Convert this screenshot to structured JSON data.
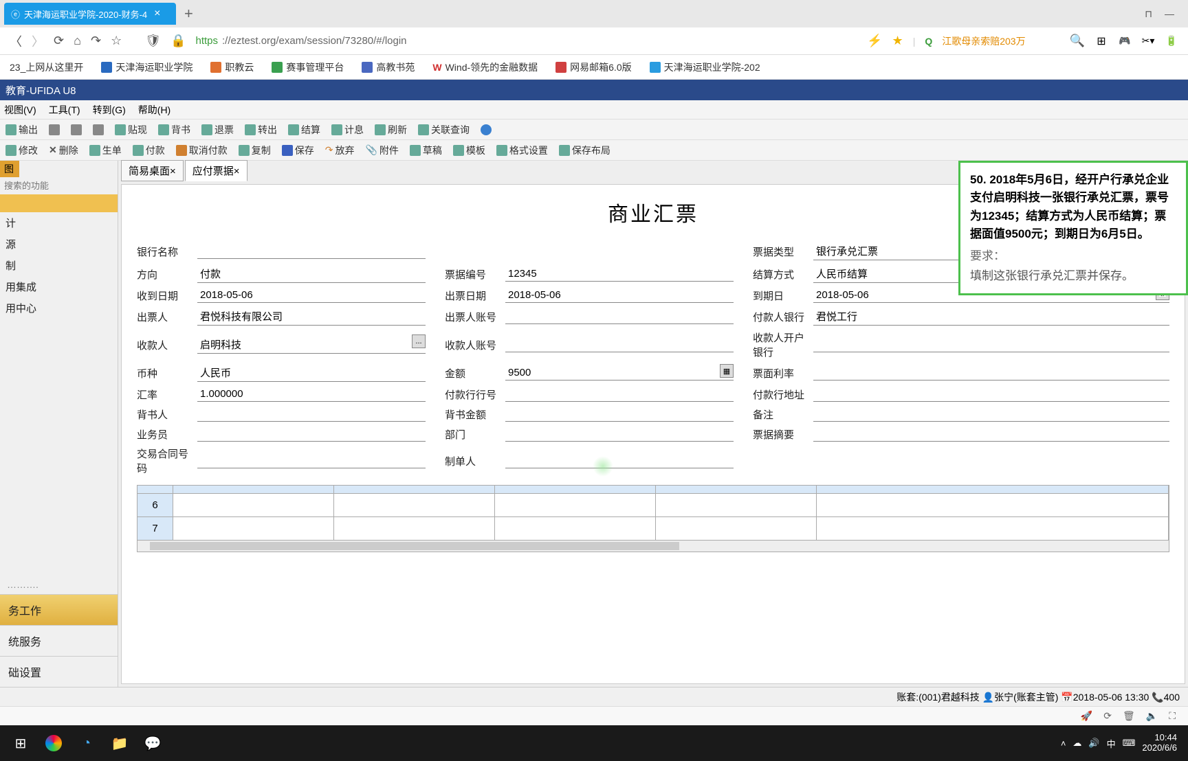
{
  "browser": {
    "tab_title": "天津海运职业学院-2020-财务-4",
    "url_scheme": "https",
    "url_host_path": "://eztest.org/exam/session/73280/#/login",
    "search_hint": "江歌母亲索赔203万",
    "win_pin": "⊓",
    "win_min": "—"
  },
  "bookmarks": [
    "23_上网从这里开",
    "天津海运职业学院",
    "职教云",
    "赛事管理平台",
    "高教书苑",
    "Wind-领先的金融数据",
    "网易邮箱6.0版",
    "天津海运职业学院-202"
  ],
  "app_title": "教育-UFIDA U8",
  "menus": [
    "视图(V)",
    "工具(T)",
    "转到(G)",
    "帮助(H)"
  ],
  "toolbar1": [
    "输出",
    "",
    "",
    "",
    "贴现",
    "背书",
    "退票",
    "转出",
    "结算",
    "计息",
    "刷新",
    "关联查询",
    ""
  ],
  "toolbar2": [
    "修改",
    "删除",
    "生单",
    "付款",
    "取消付款",
    "复制",
    "保存",
    "放弃",
    "附件",
    "草稿",
    "模板",
    "格式设置",
    "保存布局"
  ],
  "sidebar": {
    "tab": "图",
    "search_ph": "搜索的功能",
    "items": [
      "计",
      "源",
      "制",
      "用集成",
      "用中心"
    ],
    "sections": [
      "务工作",
      "统服务",
      "础设置"
    ]
  },
  "doc_tabs": [
    "简易桌面×",
    "应付票据×"
  ],
  "form": {
    "title": "商业汇票",
    "col1": [
      {
        "label": "银行名称",
        "value": ""
      },
      {
        "label": "方向",
        "value": "付款"
      },
      {
        "label": "收到日期",
        "value": "2018-05-06"
      },
      {
        "label": "出票人",
        "value": "君悦科技有限公司"
      },
      {
        "label": "收款人",
        "value": "启明科技",
        "picker": "..."
      },
      {
        "label": "币种",
        "value": "人民币"
      },
      {
        "label": "汇率",
        "value": "1.000000"
      },
      {
        "label": "背书人",
        "value": ""
      },
      {
        "label": "业务员",
        "value": ""
      },
      {
        "label": "交易合同号码",
        "value": ""
      }
    ],
    "col2": [
      {
        "label": "",
        "value": ""
      },
      {
        "label": "票据编号",
        "value": "12345"
      },
      {
        "label": "出票日期",
        "value": "2018-05-06"
      },
      {
        "label": "出票人账号",
        "value": ""
      },
      {
        "label": "收款人账号",
        "value": ""
      },
      {
        "label": "金额",
        "value": "9500",
        "picker": "▦"
      },
      {
        "label": "付款行行号",
        "value": ""
      },
      {
        "label": "背书金额",
        "value": ""
      },
      {
        "label": "部门",
        "value": ""
      },
      {
        "label": "制单人",
        "value": ""
      }
    ],
    "col3": [
      {
        "label": "票据类型",
        "value": "银行承兑汇票"
      },
      {
        "label": "结算方式",
        "value": "人民币结算"
      },
      {
        "label": "到期日",
        "value": "2018-05-06",
        "picker": "📅"
      },
      {
        "label": "付款人银行",
        "value": "君悦工行"
      },
      {
        "label": "收款人开户银行",
        "value": ""
      },
      {
        "label": "票面利率",
        "value": ""
      },
      {
        "label": "付款行地址",
        "value": ""
      },
      {
        "label": "备注",
        "value": ""
      },
      {
        "label": "票据摘要",
        "value": ""
      }
    ],
    "rows": [
      "6",
      "7"
    ]
  },
  "question": {
    "body": "50. 2018年5月6日，经开户行承兑企业支付启明科技一张银行承兑汇票，票号为12345；结算方式为人民币结算；票据面值9500元；到期日为6月5日。",
    "req_label": "要求：",
    "instruction": "填制这张银行承兑汇票并保存。"
  },
  "statusbar": "账套:(001)君越科技 👤张宁(账套主管) 📅2018-05-06 13:30 📞400",
  "tray": {
    "ime": "中",
    "time": "10:44",
    "date": "2020/6/6"
  }
}
